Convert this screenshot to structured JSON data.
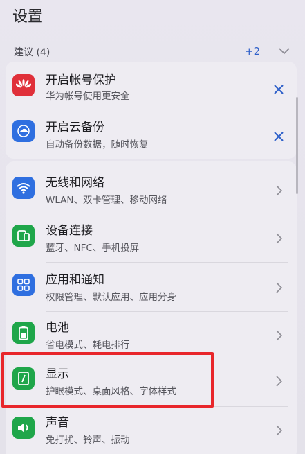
{
  "page": {
    "title": "设置"
  },
  "suggestions": {
    "header": "建议 (4)",
    "more_count": "+2",
    "items": [
      {
        "label": "开启帐号保护",
        "sub": "华为帐号使用更安全",
        "icon": "huawei-logo-icon"
      },
      {
        "label": "开启云备份",
        "sub": "自动备份数据，随时恢复",
        "icon": "cloud-backup-icon"
      }
    ]
  },
  "settings": {
    "items": [
      {
        "label": "无线和网络",
        "sub": "WLAN、双卡管理、移动网络",
        "icon": "wifi-icon"
      },
      {
        "label": "设备连接",
        "sub": "蓝牙、NFC、手机投屏",
        "icon": "device-connection-icon"
      },
      {
        "label": "应用和通知",
        "sub": "权限管理、默认应用、应用分身",
        "icon": "apps-grid-icon"
      },
      {
        "label": "电池",
        "sub": "省电模式、耗电排行",
        "icon": "battery-icon"
      },
      {
        "label": "显示",
        "sub": "护眼模式、桌面风格、字体样式",
        "icon": "display-icon"
      },
      {
        "label": "声音",
        "sub": "免打扰、铃声、振动",
        "icon": "speaker-icon"
      }
    ]
  },
  "colors": {
    "accent_blue": "#2d5fc9",
    "huawei_red": "#e0303a",
    "wifi_blue": "#2f6fe0",
    "green": "#1fa64a",
    "highlight_red": "#e8262b"
  }
}
